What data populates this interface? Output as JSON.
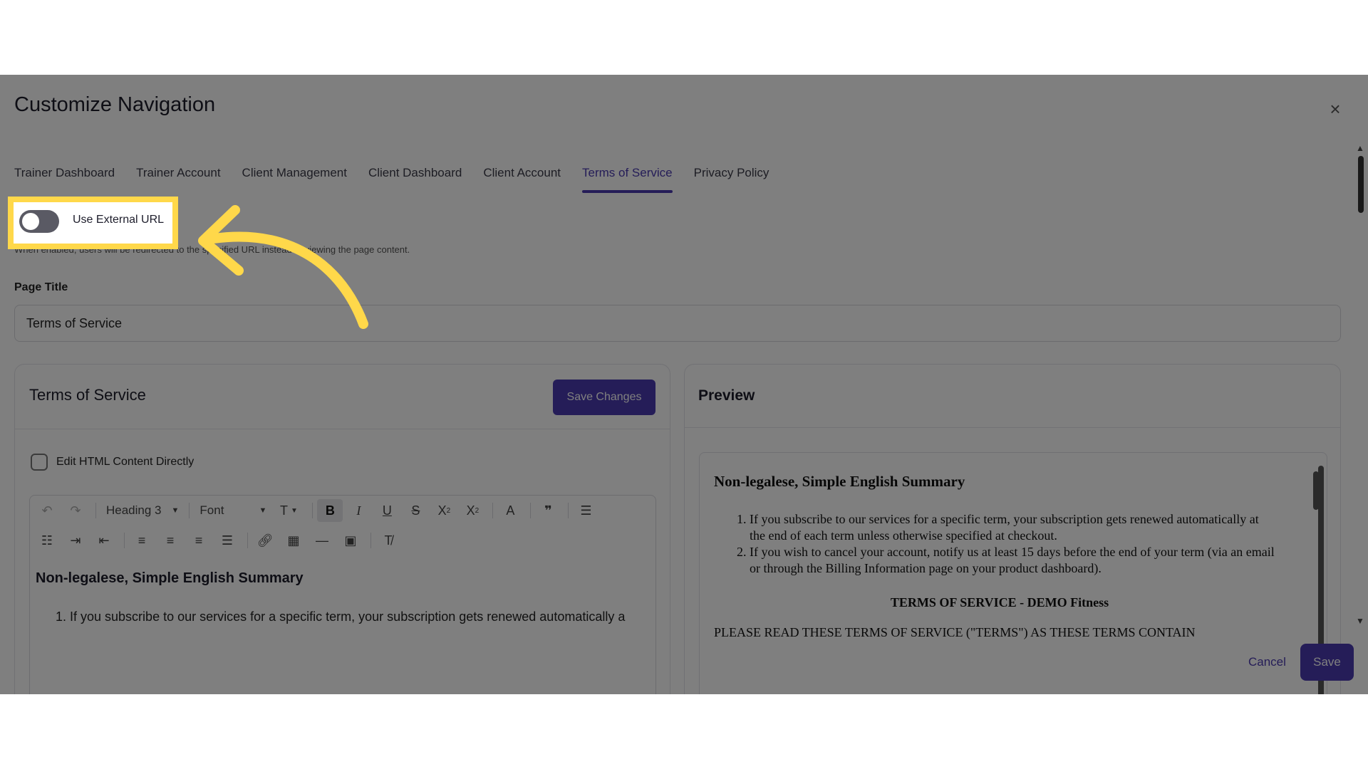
{
  "modal": {
    "title": "Customize Navigation",
    "close_icon": "close-icon"
  },
  "tabs": [
    {
      "label": "Trainer Dashboard",
      "active": false
    },
    {
      "label": "Trainer Account",
      "active": false
    },
    {
      "label": "Client Management",
      "active": false
    },
    {
      "label": "Client Dashboard",
      "active": false
    },
    {
      "label": "Client Account",
      "active": false
    },
    {
      "label": "Terms of Service",
      "active": true
    },
    {
      "label": "Privacy Policy",
      "active": false
    }
  ],
  "external_url": {
    "toggle_label": "Use External URL",
    "enabled": false,
    "help_text": "When enabled, users will be redirected to the specified URL instead of viewing the page content."
  },
  "page_title": {
    "label": "Page Title",
    "value": "Terms of Service"
  },
  "editor_panel": {
    "title": "Terms of Service",
    "save_changes_label": "Save Changes",
    "edit_html_label": "Edit HTML Content Directly",
    "edit_html_checked": false,
    "toolbar": {
      "heading_select": "Heading 3",
      "font_select": "Font"
    },
    "content_heading": "Non-legalese, Simple English Summary",
    "content_first_item": "1. If you subscribe to our services for a specific term, your subscription gets renewed automatically a"
  },
  "preview_panel": {
    "title": "Preview",
    "heading": "Non-legalese, Simple English Summary",
    "items": [
      "If you subscribe to our services for a specific term, your subscription gets renewed automatically at the end of each term unless otherwise specified at checkout.",
      "If you wish to cancel your account, notify us at least 15 days before the end of your term (via an email or through the Billing Information page on your product dashboard)."
    ],
    "section_title": "TERMS OF SERVICE - DEMO Fitness",
    "cut_line": "PLEASE READ THESE TERMS OF SERVICE (\"TERMS\") AS THESE TERMS CONTAIN"
  },
  "footer": {
    "cancel_label": "Cancel",
    "save_label": "Save"
  },
  "colors": {
    "accent": "#4b3bb0",
    "highlight": "#ffd84a",
    "annotation_arrow": "#ffd84a"
  }
}
